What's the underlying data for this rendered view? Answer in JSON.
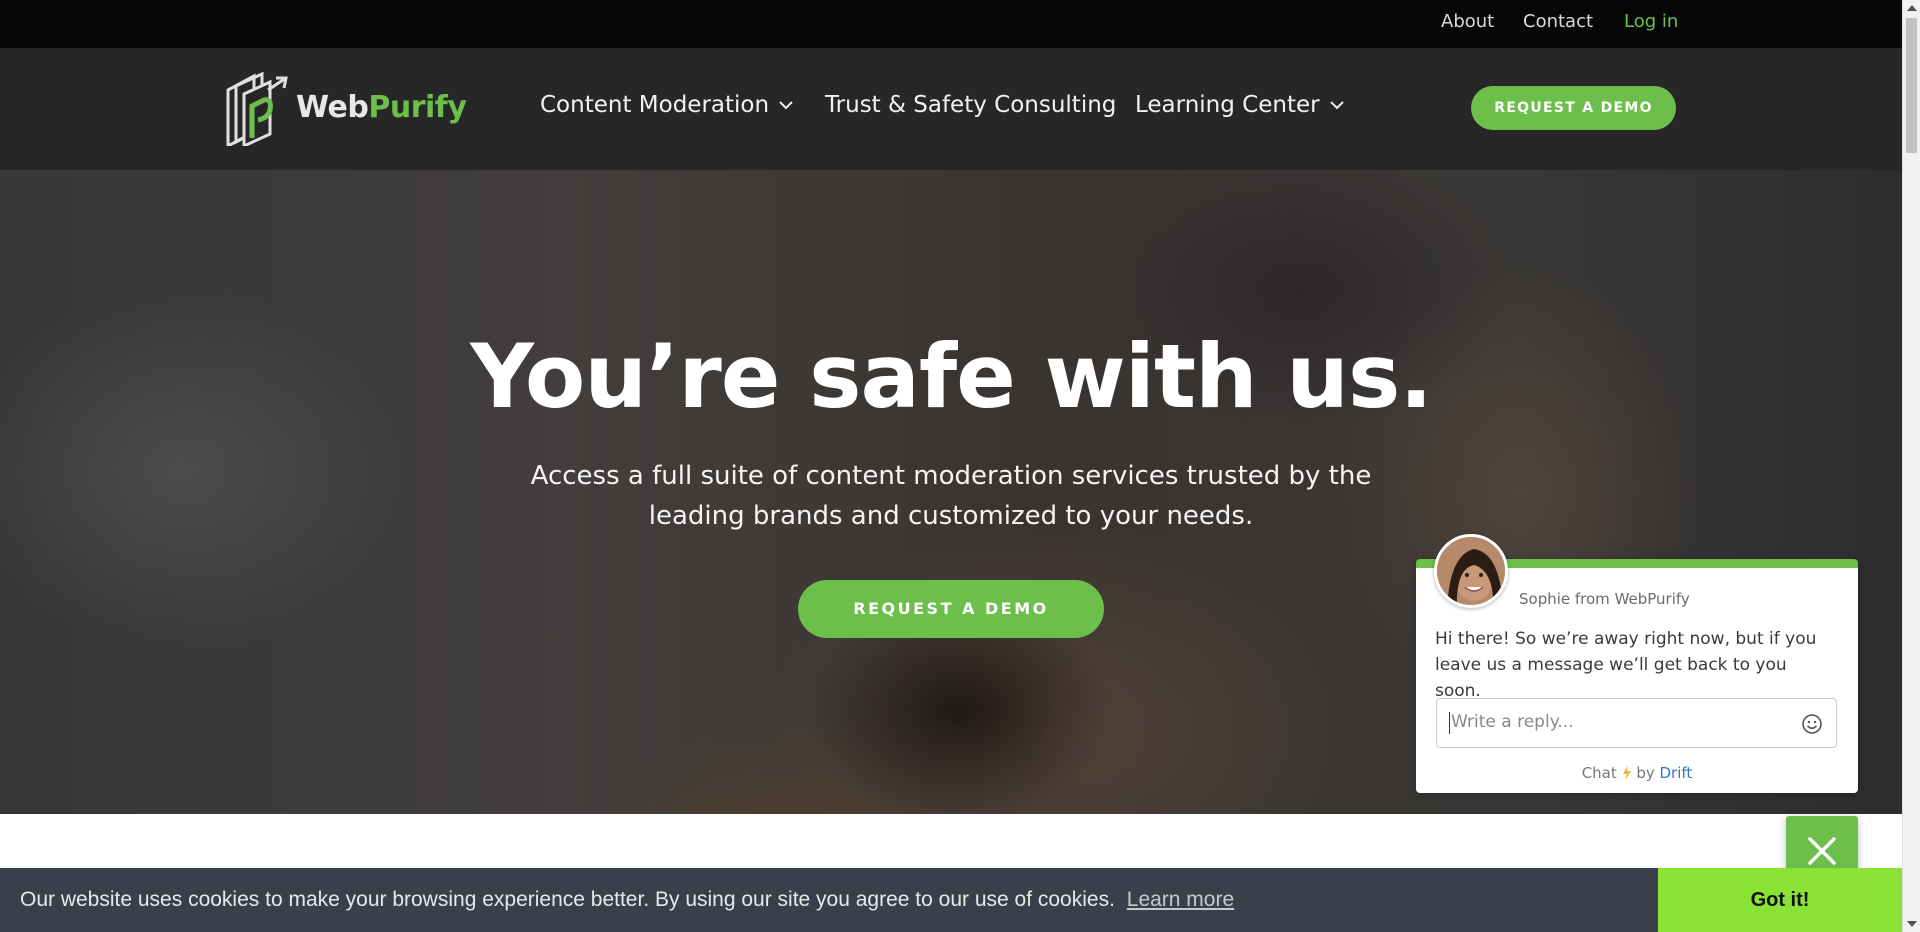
{
  "topbar": {
    "about": "About",
    "contact": "Contact",
    "login": "Log in"
  },
  "brand": {
    "name_part1": "Web",
    "name_part2": "Purify"
  },
  "nav": {
    "items": [
      {
        "label": "Content Moderation",
        "has_dropdown": true
      },
      {
        "label": "Trust & Safety Consulting",
        "has_dropdown": false
      },
      {
        "label": "Learning Center",
        "has_dropdown": true
      }
    ],
    "demo_button": "REQUEST A DEMO"
  },
  "hero": {
    "title": "You’re safe with us.",
    "subtitle": "Access a full suite of content moderation services trusted by the leading brands and customized to your needs.",
    "cta": "REQUEST A DEMO"
  },
  "chat": {
    "agent": "Sophie from WebPurify",
    "message": "Hi there! So we’re away right now, but if you leave us a message we’ll get back to you soon.",
    "input_placeholder": "Write a reply...",
    "footer_prefix": "Chat",
    "footer_by": "by",
    "footer_brand": "Drift"
  },
  "cookie": {
    "text": "Our website uses cookies to make your browsing experience better. By using our site you agree to our use of cookies.",
    "learn_more": "Learn more",
    "accept": "Got it!"
  },
  "colors": {
    "accent_green": "#6cbf4a",
    "cookie_button": "#8ae234",
    "nav_bg": "#272727",
    "topbar_bg": "#070707",
    "cookie_bg": "#3a3f4b",
    "drift_blue": "#2f78c4"
  },
  "icons": [
    "webpurify-logo-icon",
    "chevron-down-icon",
    "emoji-icon",
    "lightning-icon",
    "close-icon"
  ]
}
